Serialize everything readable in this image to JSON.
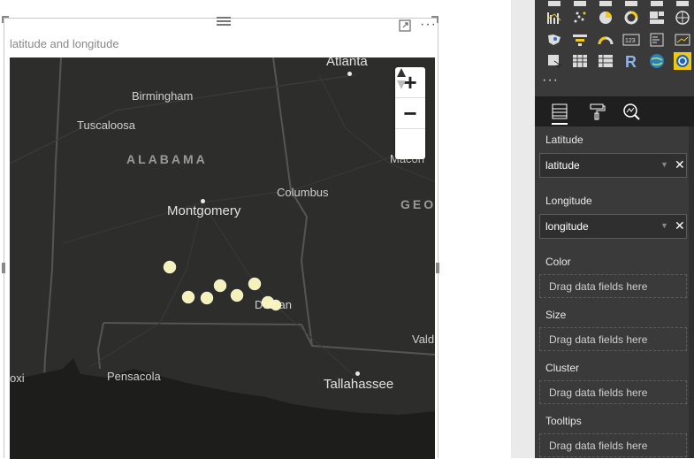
{
  "visual": {
    "title": "latitude and longitude",
    "more_glyph": "···",
    "zoom_in": "+",
    "zoom_out": "−"
  },
  "map": {
    "labels": {
      "atlanta": "Atlanta",
      "birmingham": "Birmingham",
      "tuscaloosa": "Tuscaloosa",
      "alabama": "ALABAMA",
      "macon": "Macon",
      "columbus": "Columbus",
      "georgia": "GEO",
      "montgomery": "Montgomery",
      "dothan": "Dothan",
      "valdosta": "Vald",
      "biloxi": "oxi",
      "pensacola": "Pensacola",
      "tallahassee": "Tallahassee"
    },
    "point_color": "#fffdc2"
  },
  "panel": {
    "more_glyph": "···",
    "wells": [
      {
        "label": "Latitude",
        "field": "latitude"
      },
      {
        "label": "Longitude",
        "field": "longitude"
      },
      {
        "label": "Color",
        "placeholder": "Drag data fields here"
      },
      {
        "label": "Size",
        "placeholder": "Drag data fields here"
      },
      {
        "label": "Cluster",
        "placeholder": "Drag data fields here"
      },
      {
        "label": "Tooltips",
        "placeholder": "Drag data fields here"
      }
    ],
    "remove_glyph": "✕",
    "dropdown_glyph": "▼",
    "icons": [
      "line-chart-icon",
      "scatter-chart-icon",
      "pie-chart-icon",
      "donut-chart-icon",
      "treemap-icon",
      "globe-map-icon",
      "filled-map-icon",
      "funnel-icon",
      "gauge-icon",
      "card-icon",
      "multi-row-card-icon",
      "kpi-icon",
      "slicer-icon",
      "table-icon",
      "matrix-icon",
      "r-visual-icon",
      "arcgis-globe-icon",
      "custom-map-icon"
    ]
  },
  "colors": {
    "accent": "#f2c811",
    "panel_bg": "#3a3a3a",
    "map_bg": "#2d2d2b"
  }
}
